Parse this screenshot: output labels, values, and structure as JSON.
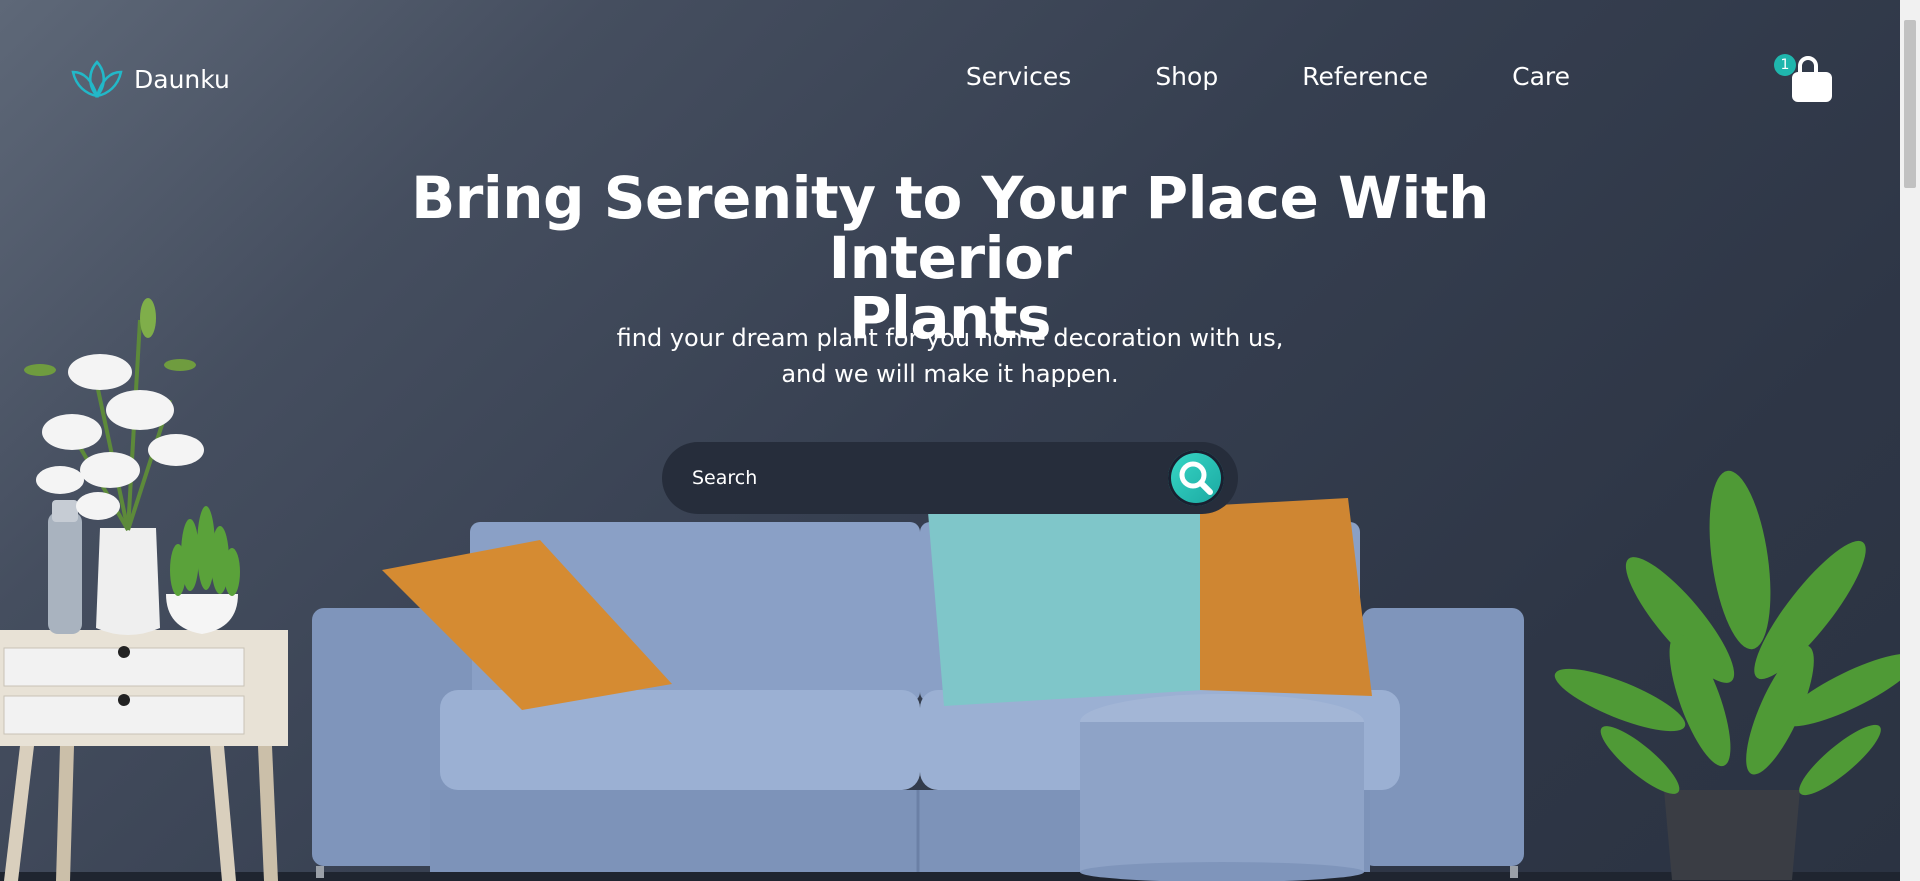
{
  "brand": {
    "name": "Daunku"
  },
  "nav": {
    "items": [
      "Services",
      "Shop",
      "Reference",
      "Care"
    ]
  },
  "cart": {
    "count": "1"
  },
  "hero": {
    "headline_line1": "Bring Serenity to Your Place With Interior",
    "headline_line2": "Plants",
    "sub_line1": "find your dream plant for you home decoration with us,",
    "sub_line2": "and we will make it happen."
  },
  "search": {
    "placeholder": "Search"
  },
  "colors": {
    "accent": "#1fb6ad",
    "background": "#363f50",
    "search_bg": "#262d3b"
  },
  "icons": [
    "lotus-logo-icon",
    "shopping-bag-icon",
    "search-icon"
  ]
}
